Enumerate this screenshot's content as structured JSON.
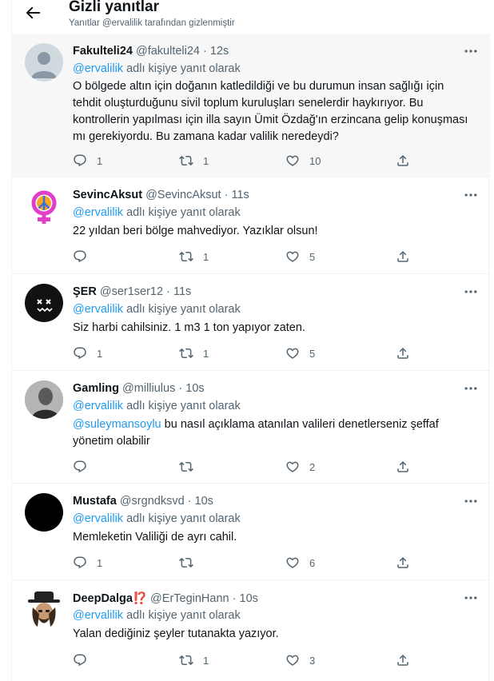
{
  "header": {
    "title": "Gizli yanıtlar",
    "subtitle": "Yanıtlar @ervalilik tarafından gizlenmiştir"
  },
  "tweets": [
    {
      "name": "Fakulteli24",
      "badge": "",
      "handle": "@fakulteli24",
      "time": "12s",
      "reply_prefix": "@ervalilik",
      "reply_suffix": "adlı kişiye yanıt olarak",
      "text": "O bölgede altın için doğanın katledildiği ve bu durumun insan sağlığı için tehdit oluşturduğunu sivil toplum kuruluşları senelerdir haykırıyor. Bu kontrollerin yapılması için illa sayın Ümit Özdağ'ın erzincana gelip konuşması mı gerekiyordu. Bu zamana kadar valilik neredeydi?",
      "mention": "",
      "replies": "1",
      "retweets": "1",
      "likes": "10"
    },
    {
      "name": "SevincAksut",
      "badge": "",
      "handle": "@SevincAksut",
      "time": "11s",
      "reply_prefix": "@ervalilik",
      "reply_suffix": "adlı kişiye yanıt olarak",
      "text": "22 yıldan beri bölge mahvediyor. Yazıklar olsun!",
      "mention": "",
      "replies": "",
      "retweets": "1",
      "likes": "5"
    },
    {
      "name": "ŞER",
      "badge": "",
      "handle": "@ser1ser12",
      "time": "11s",
      "reply_prefix": "@ervalilik",
      "reply_suffix": "adlı kişiye yanıt olarak",
      "text": "Siz harbi cahilsiniz. 1 m3 1 ton yapıyor zaten.",
      "mention": "",
      "replies": "1",
      "retweets": "1",
      "likes": "5"
    },
    {
      "name": "Gamling",
      "badge": "",
      "handle": "@milliulus",
      "time": "10s",
      "reply_prefix": "@ervalilik",
      "reply_suffix": "adlı kişiye yanıt olarak",
      "text": "bu nasıl açıklama atanılan valileri denetlerseniz şeffaf yönetim olabilir",
      "mention": "@suleymansoylu",
      "replies": "",
      "retweets": "",
      "likes": "2"
    },
    {
      "name": "Mustafa",
      "badge": "",
      "handle": "@srgndksvd",
      "time": "10s",
      "reply_prefix": "@ervalilik",
      "reply_suffix": "adlı kişiye yanıt olarak",
      "text": "Memleketin Valiliği de ayrı cahil.",
      "mention": "",
      "replies": "1",
      "retweets": "",
      "likes": "6"
    },
    {
      "name": "DeepDalga",
      "badge": "⁉️",
      "handle": "@ErTeginHann",
      "time": "10s",
      "reply_prefix": "@ervalilik",
      "reply_suffix": "adlı kişiye yanıt olarak",
      "text": "Yalan dediğiniz şeyler tutanakta yazıyor.",
      "mention": "",
      "replies": "",
      "retweets": "1",
      "likes": "3"
    }
  ],
  "colors": {
    "accent": "#1d9bf0",
    "secondary_text": "#536471",
    "primary_text": "#0f1419",
    "highlight_bg": "#f7f7f7",
    "divider": "#eff3f4"
  },
  "icons": [
    "back-arrow-icon",
    "more-icon",
    "reply-icon",
    "retweet-icon",
    "like-icon",
    "share-icon"
  ]
}
